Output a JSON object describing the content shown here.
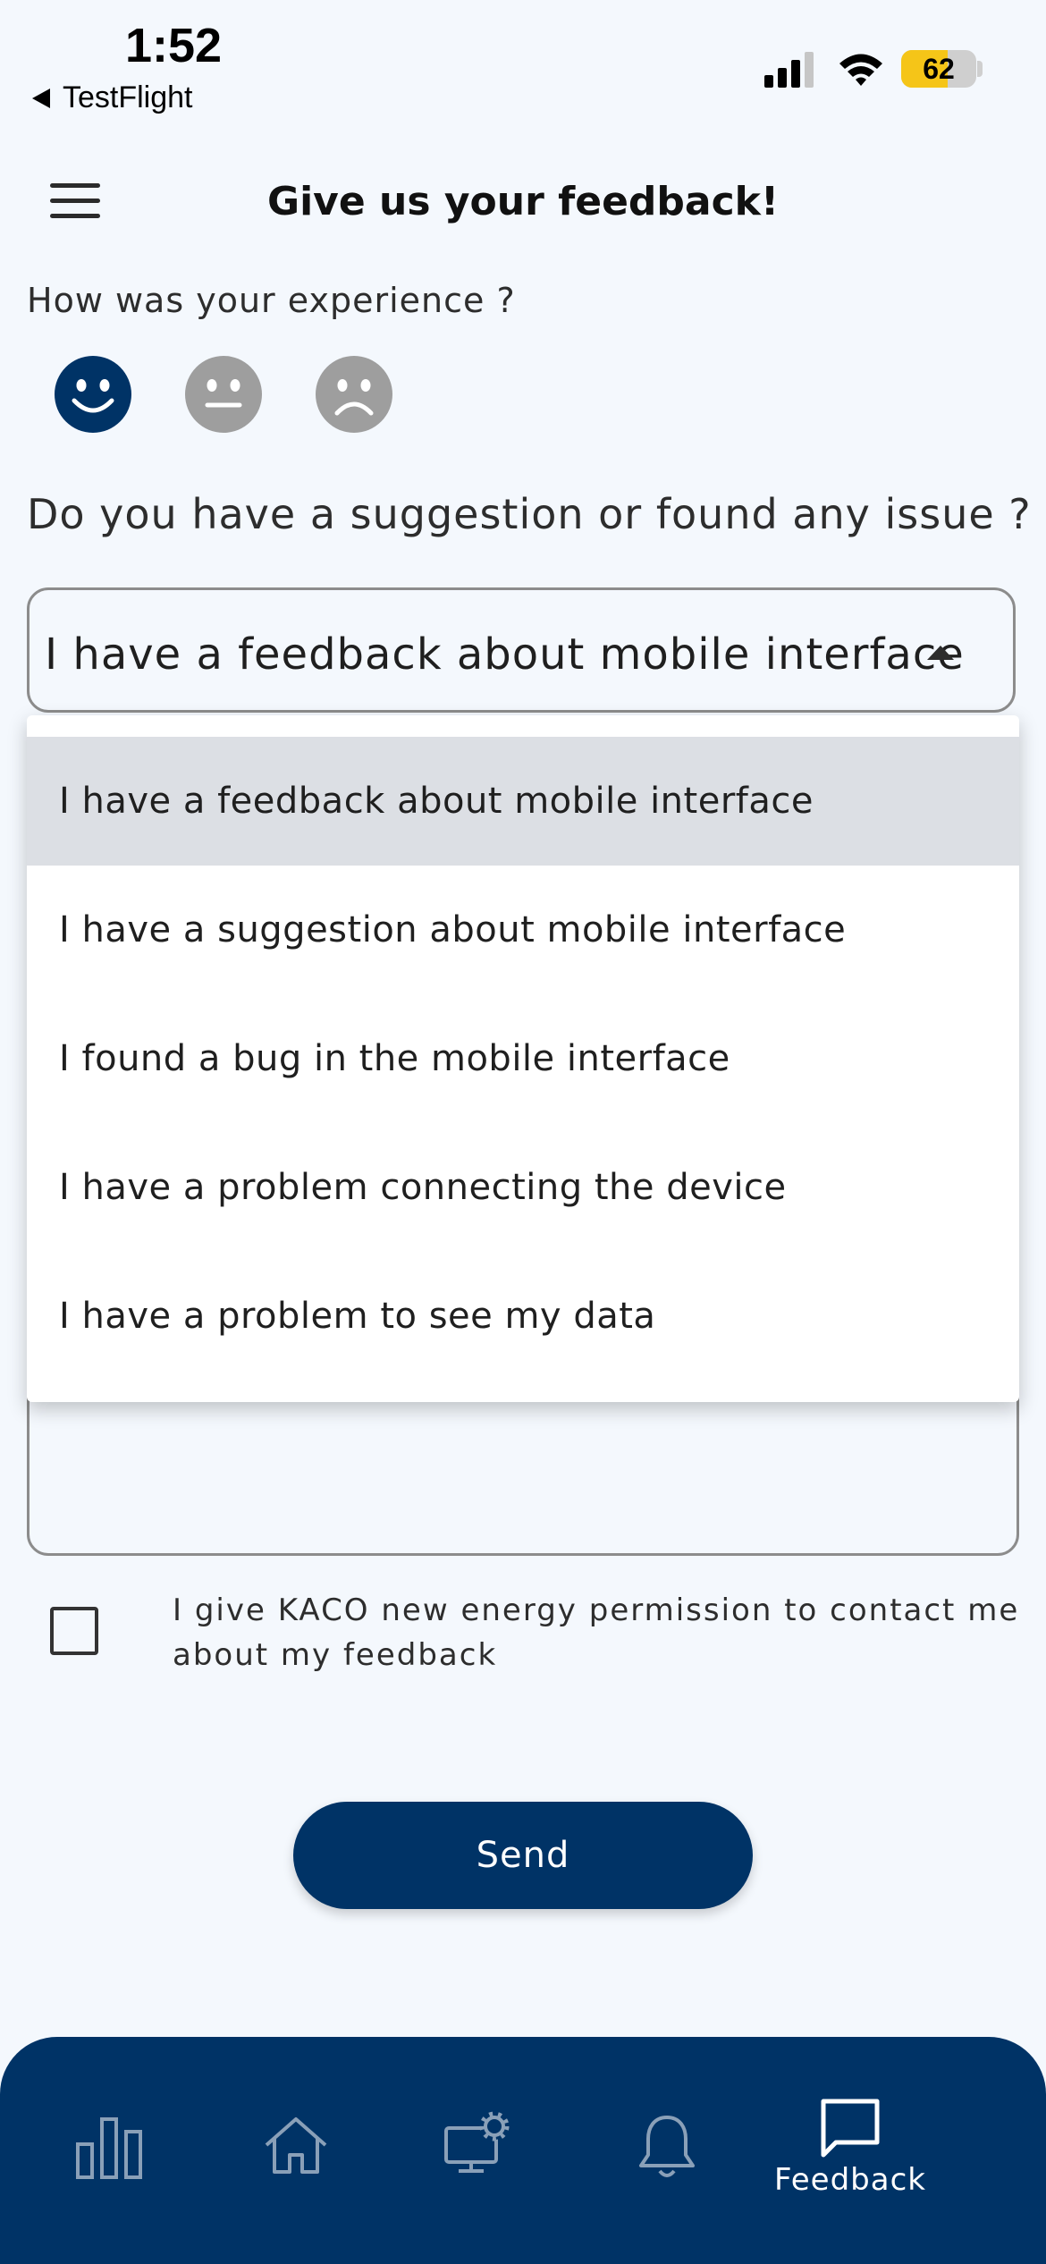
{
  "status_bar": {
    "time": "1:52",
    "back_app": "TestFlight",
    "battery_level": "62"
  },
  "header": {
    "title": "Give us your feedback!"
  },
  "experience": {
    "label": "How was your experience ?",
    "options": [
      "happy-face-icon",
      "neutral-face-icon",
      "sad-face-icon"
    ],
    "selected": "happy"
  },
  "issue": {
    "label": "Do you have a suggestion or found any issue ?",
    "selected_value": "I have a feedback about mobile interface",
    "options": [
      "I have a feedback about mobile interface",
      "I have a suggestion about mobile interface",
      "I found a bug in the mobile interface",
      "I have a problem connecting the device",
      "I have a problem to see my data"
    ]
  },
  "consent": {
    "text": "I give KACO new energy permission to contact me about my feedback",
    "checked": false
  },
  "send_label": "Send",
  "bottom_nav": {
    "items": [
      "chart-icon",
      "home-icon",
      "device-settings-icon",
      "bell-icon",
      "feedback-icon"
    ],
    "active_label": "Feedback"
  },
  "colors": {
    "primary": "#003366",
    "background": "#f4f8fd",
    "inactive_face": "#9e9e9e",
    "selected_option_bg": "#dcdfe4",
    "battery": "#f5c518"
  }
}
